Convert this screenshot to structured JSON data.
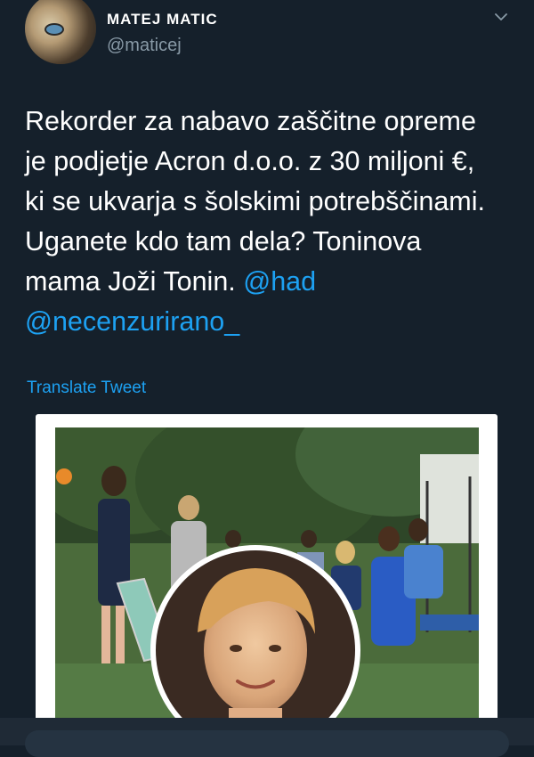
{
  "user": {
    "name": "MATEJ MATIC",
    "handle": "@maticej"
  },
  "tweet": {
    "line1": "Rekorder za nabavo zaščitne opreme",
    "line2": "je podjetje Acron d.o.o. z 30 miljoni €,",
    "line3": "ki se ukvarja s šolskimi potrebščinami.",
    "line4": "Uganete kdo tam dela? Toninova",
    "line5": "mama Joži Tonin. ",
    "mention1": "@had",
    "mention2": "@necenzurirano_"
  },
  "actions": {
    "translate": "Translate Tweet"
  },
  "icons": {
    "menu": "chevron-down-icon"
  },
  "colors": {
    "background": "#15202b",
    "link": "#1da1f2",
    "secondary": "#8899a6"
  }
}
